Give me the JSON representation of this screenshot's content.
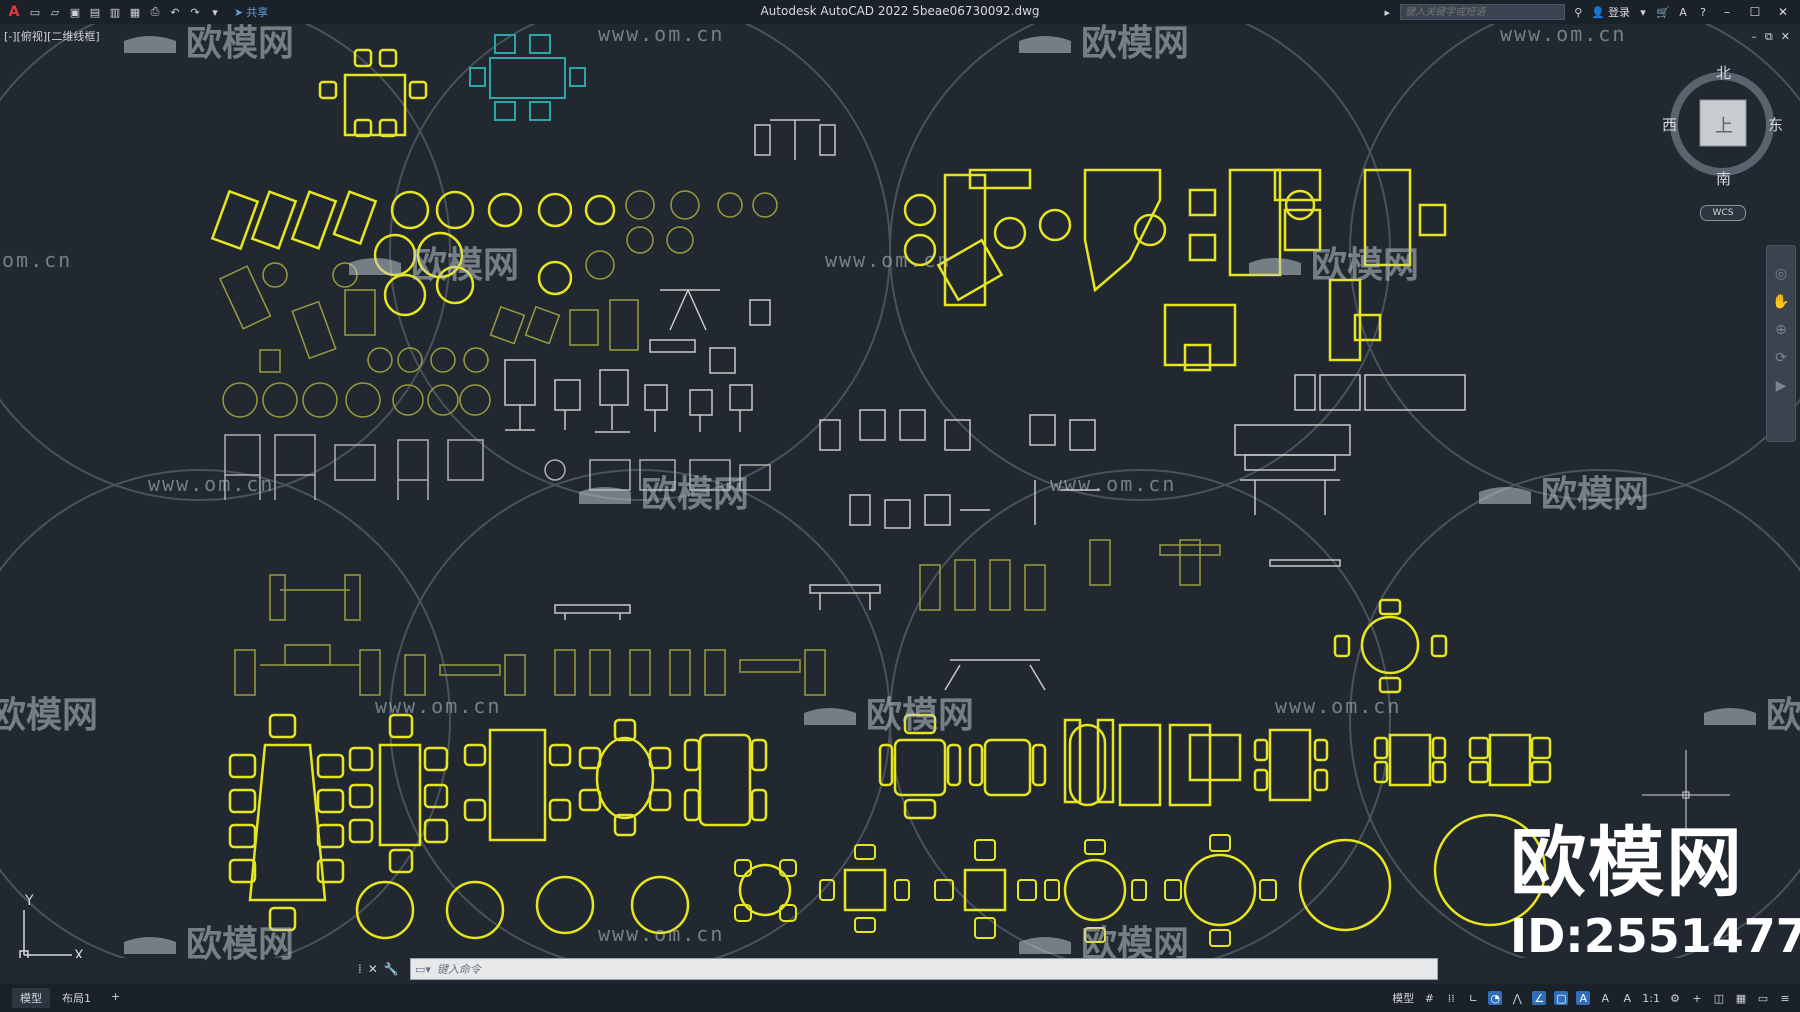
{
  "app": {
    "title": "Autodesk AutoCAD 2022    5beae06730092.dwg",
    "share_label": "共享",
    "search_placeholder": "键入关键字或短语",
    "login_label": "登录"
  },
  "viewport": {
    "label": "[-][俯视][二维线框]"
  },
  "viewcube": {
    "north": "北",
    "south": "南",
    "east": "东",
    "west": "西",
    "face": "上",
    "wcs": "WCS"
  },
  "ucs": {
    "x": "X",
    "y": "Y"
  },
  "command": {
    "placeholder": "键入命令"
  },
  "layout_tabs": [
    "模型",
    "布局1",
    "+"
  ],
  "status": {
    "model_label": "模型",
    "scale": "1:1"
  },
  "watermark": {
    "brand": "欧模网",
    "id": "ID:2551477",
    "text": "欧模网",
    "url": "www.om.cn",
    "url_partial": "om.cn"
  },
  "colors": {
    "background": "#212830",
    "yellow": "#e6e620",
    "olive": "#9a9a40",
    "cyan": "#2aa6a6",
    "white": "#d0d3d8"
  }
}
